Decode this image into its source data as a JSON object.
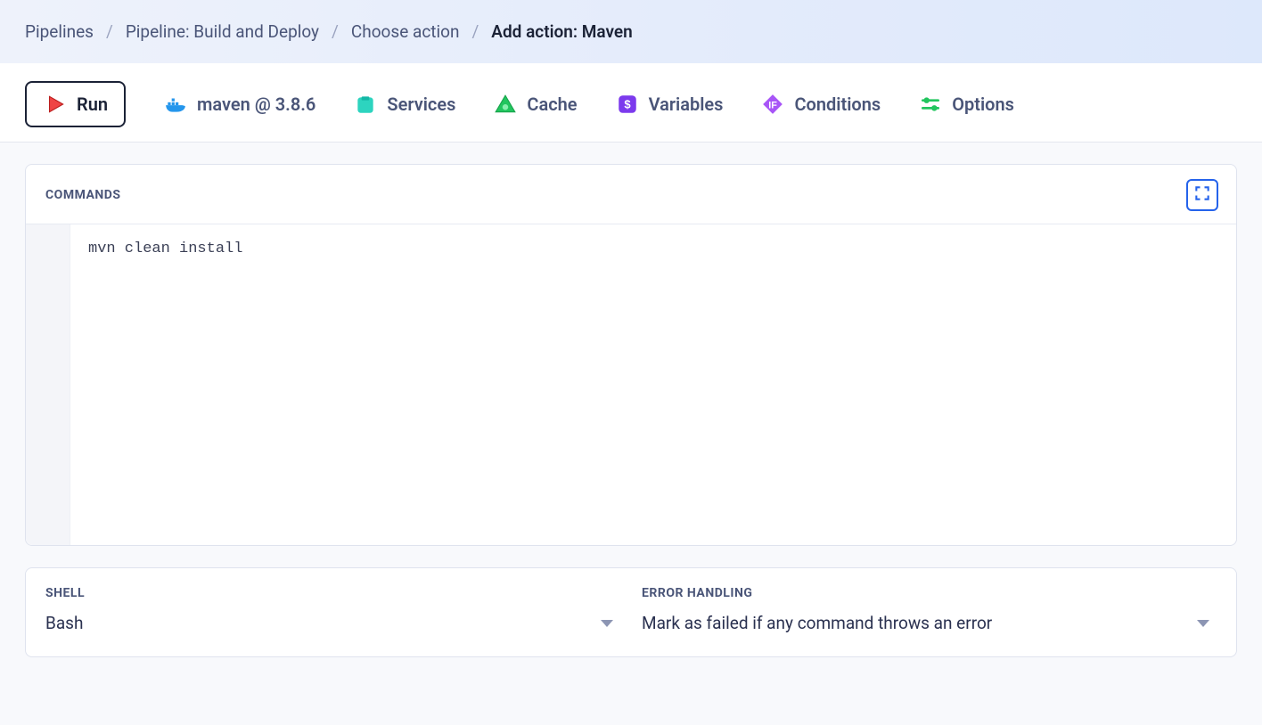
{
  "breadcrumb": {
    "items": [
      {
        "label": "Pipelines"
      },
      {
        "label": "Pipeline: Build and Deploy"
      },
      {
        "label": "Choose action"
      }
    ],
    "current": "Add action: Maven"
  },
  "tabs": {
    "run": {
      "label": "Run"
    },
    "image": {
      "label": "maven @ 3.8.6"
    },
    "services": {
      "label": "Services"
    },
    "cache": {
      "label": "Cache"
    },
    "variables": {
      "label": "Variables"
    },
    "conditions": {
      "label": "Conditions"
    },
    "options": {
      "label": "Options"
    }
  },
  "commands": {
    "label": "COMMANDS",
    "content": "mvn clean install"
  },
  "shell": {
    "label": "SHELL",
    "value": "Bash"
  },
  "error_handling": {
    "label": "ERROR HANDLING",
    "value": "Mark as failed if any command throws an error"
  }
}
